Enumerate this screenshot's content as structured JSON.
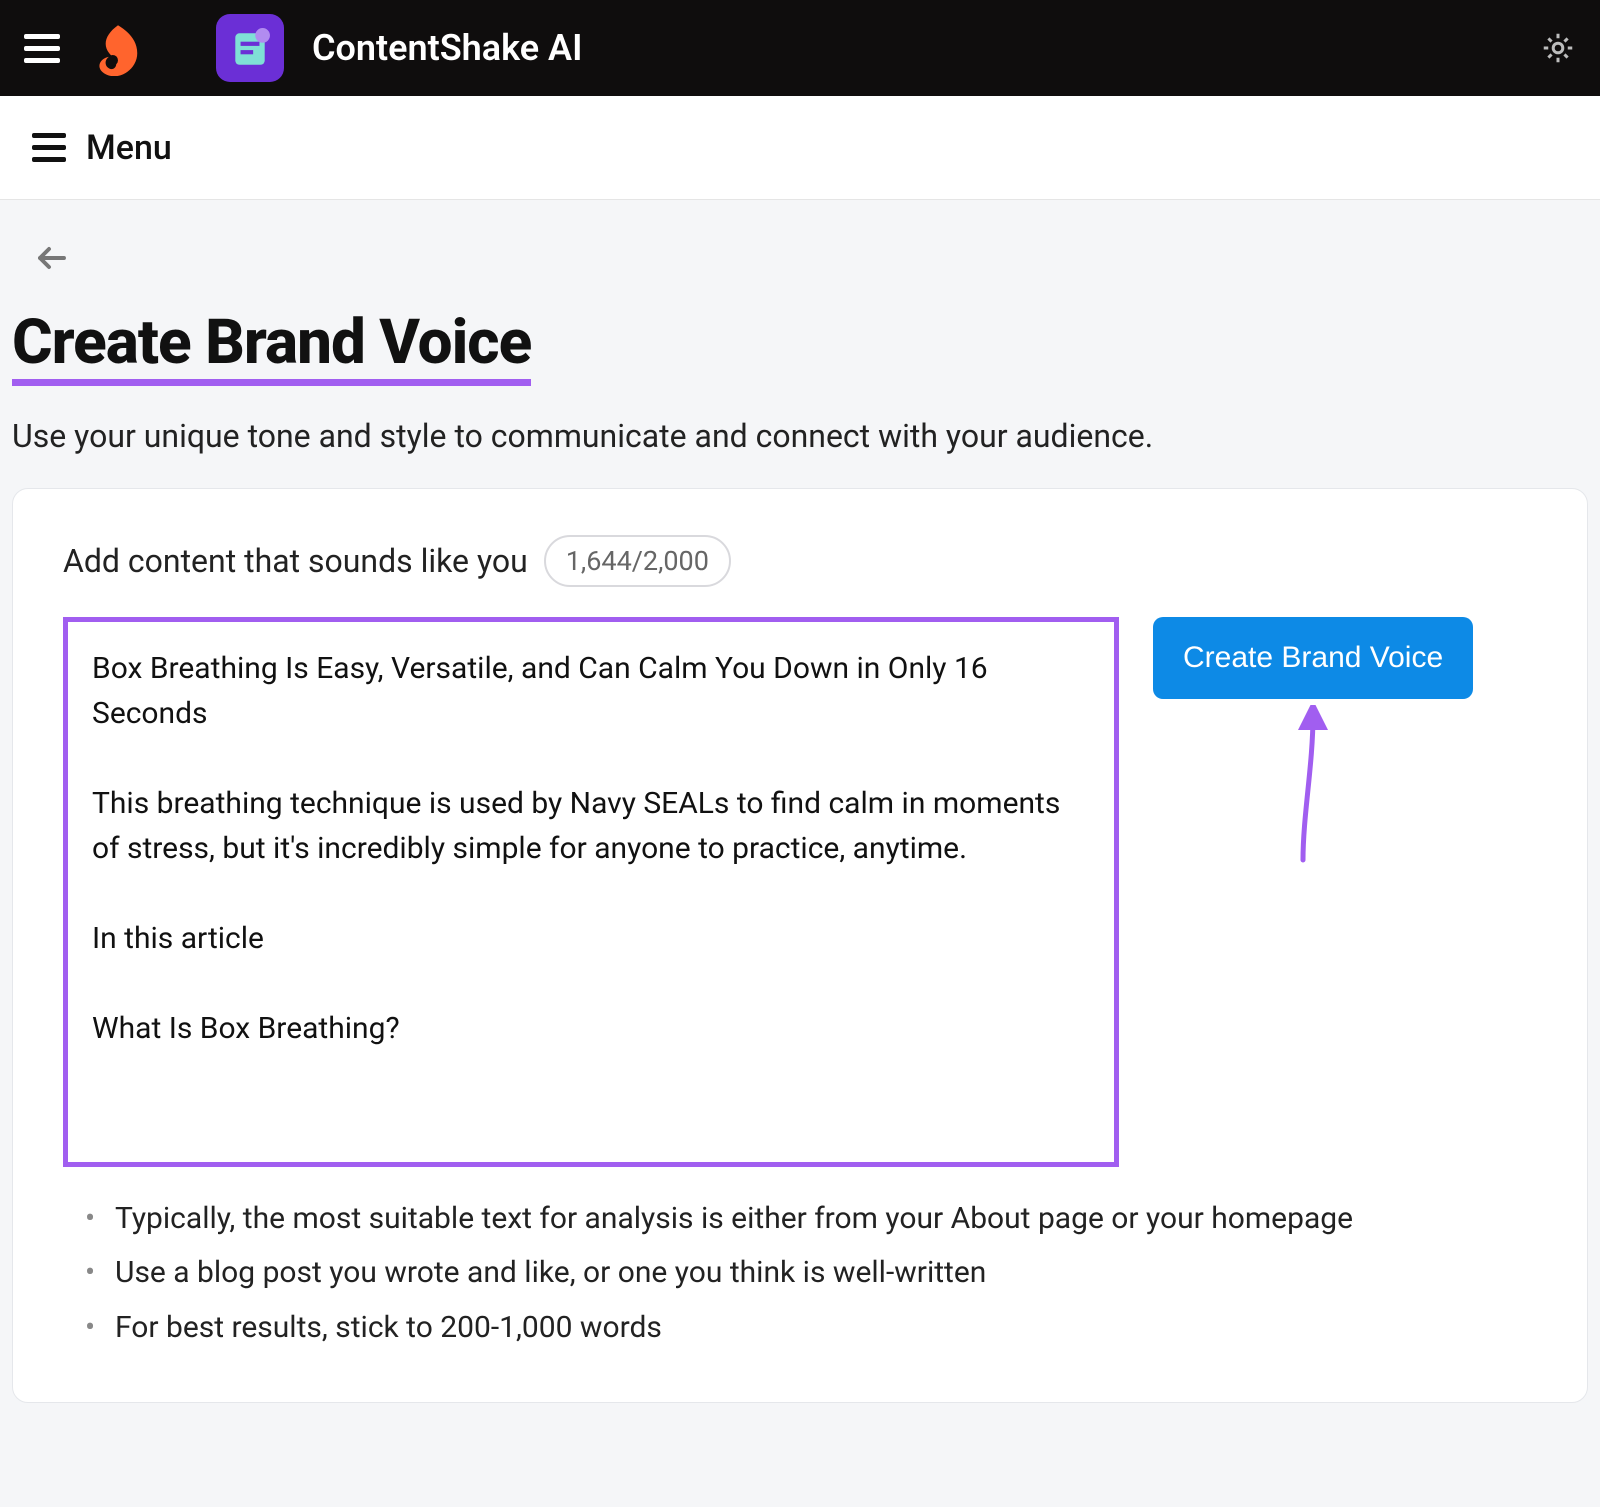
{
  "header": {
    "app_title": "ContentShake AI"
  },
  "menubar": {
    "label": "Menu"
  },
  "page": {
    "title": "Create Brand Voice",
    "subtitle": "Use your unique tone and style to communicate and connect with your audience."
  },
  "editor": {
    "prompt_label": "Add content that sounds like you",
    "char_counter": "1,644/2,000",
    "content": "Box Breathing Is Easy, Versatile, and Can Calm You Down in Only 16 Seconds\n\nThis breathing technique is used by Navy SEALs to find calm in moments of stress, but it's incredibly simple for anyone to practice, anytime.\n\nIn this article\n\nWhat Is Box Breathing?",
    "cta_label": "Create Brand Voice"
  },
  "tips": [
    "Typically, the most suitable text for analysis is either from your About page or your homepage",
    "Use a blog post you wrote and like, or one you think is well-written",
    "For best results, stick to 200-1,000 words"
  ]
}
